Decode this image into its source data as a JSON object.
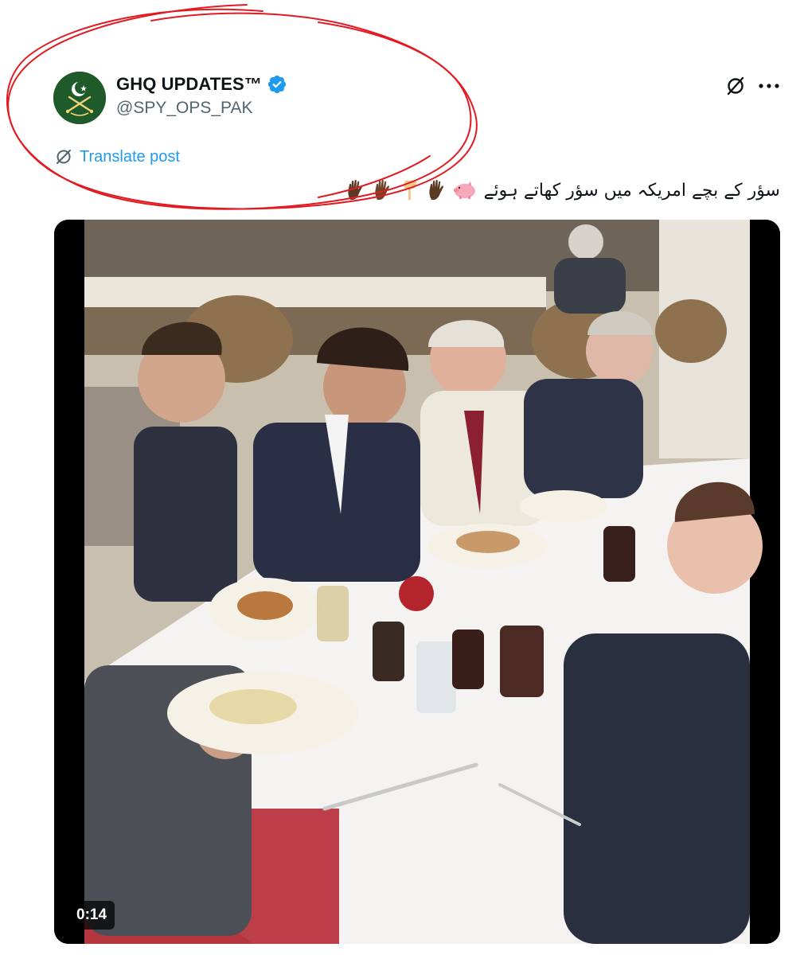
{
  "post": {
    "author": {
      "display_name": "GHQ UPDATES™",
      "handle": "@SPY_OPS_PAK",
      "verified": true,
      "avatar_icon": "crescent-star-crossed-swords-icon",
      "verified_icon": "verified-badge-icon"
    },
    "actions": {
      "grok_icon": "grok-icon",
      "more_icon": "more-horizontal-icon"
    },
    "translate": {
      "label": "Translate post",
      "icon": "translate-icon"
    },
    "text": "سؤر کے بچے امریکہ میں سؤر کھاتے ہوئے",
    "emojis": [
      "pig-icon",
      "raised-hand-icon",
      "pointing-down-icon",
      "raised-hand-icon",
      "raised-hand-icon"
    ],
    "video": {
      "duration": "0:14",
      "description_icon": "video-thumbnail"
    }
  },
  "colors": {
    "accent": "#1d9bf0",
    "text_secondary": "#536471",
    "annotation": "#e11b22",
    "avatar_bg": "#1f5a2a"
  }
}
